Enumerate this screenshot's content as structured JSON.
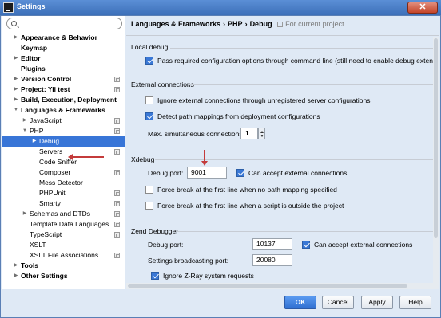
{
  "window": {
    "title": "Settings",
    "close_label": "✕"
  },
  "search": {
    "value": "",
    "placeholder": ""
  },
  "tree": [
    {
      "label": "Appearance & Behavior",
      "bold": true,
      "arrow": "▶",
      "indent": 0
    },
    {
      "label": "Keymap",
      "bold": true,
      "arrow": "",
      "indent": 0
    },
    {
      "label": "Editor",
      "bold": true,
      "arrow": "▶",
      "indent": 0
    },
    {
      "label": "Plugins",
      "bold": true,
      "arrow": "",
      "indent": 0
    },
    {
      "label": "Version Control",
      "bold": true,
      "arrow": "▶",
      "indent": 0,
      "project": true
    },
    {
      "label": "Project: Yii test",
      "bold": true,
      "arrow": "▶",
      "indent": 0,
      "project": true
    },
    {
      "label": "Build, Execution, Deployment",
      "bold": true,
      "arrow": "▶",
      "indent": 0
    },
    {
      "label": "Languages & Frameworks",
      "bold": true,
      "arrow": "▼",
      "indent": 0
    },
    {
      "label": "JavaScript",
      "bold": false,
      "arrow": "▶",
      "indent": 1,
      "project": true
    },
    {
      "label": "PHP",
      "bold": false,
      "arrow": "▼",
      "indent": 1,
      "project": true
    },
    {
      "label": "Debug",
      "bold": false,
      "arrow": "▶",
      "indent": 2,
      "selected": true
    },
    {
      "label": "Servers",
      "bold": false,
      "arrow": "",
      "indent": 2,
      "project": true
    },
    {
      "label": "Code Sniffer",
      "bold": false,
      "arrow": "",
      "indent": 2
    },
    {
      "label": "Composer",
      "bold": false,
      "arrow": "",
      "indent": 2,
      "project": true
    },
    {
      "label": "Mess Detector",
      "bold": false,
      "arrow": "",
      "indent": 2
    },
    {
      "label": "PHPUnit",
      "bold": false,
      "arrow": "",
      "indent": 2,
      "project": true
    },
    {
      "label": "Smarty",
      "bold": false,
      "arrow": "",
      "indent": 2,
      "project": true
    },
    {
      "label": "Schemas and DTDs",
      "bold": false,
      "arrow": "▶",
      "indent": 1,
      "project": true
    },
    {
      "label": "Template Data Languages",
      "bold": false,
      "arrow": "",
      "indent": 1,
      "project": true
    },
    {
      "label": "TypeScript",
      "bold": false,
      "arrow": "",
      "indent": 1,
      "project": true
    },
    {
      "label": "XSLT",
      "bold": false,
      "arrow": "",
      "indent": 1
    },
    {
      "label": "XSLT File Associations",
      "bold": false,
      "arrow": "",
      "indent": 1,
      "project": true
    },
    {
      "label": "Tools",
      "bold": true,
      "arrow": "▶",
      "indent": 0
    },
    {
      "label": "Other Settings",
      "bold": true,
      "arrow": "▶",
      "indent": 0
    }
  ],
  "breadcrumb": {
    "part1": "Languages & Frameworks",
    "sep": "›",
    "part2": "PHP",
    "part3": "Debug",
    "for_current_project": "For current project"
  },
  "local_debug": {
    "title": "Local debug",
    "pass_config_label": "Pass required configuration options through command line (still need to enable debug extension manu",
    "pass_config_checked": true
  },
  "external": {
    "title": "External connections",
    "ignore_label": "Ignore external connections through unregistered server configurations",
    "ignore_checked": false,
    "detect_label": "Detect path mappings from deployment configurations",
    "detect_checked": true,
    "max_label": "Max. simultaneous connections:",
    "max_value": "1"
  },
  "xdebug": {
    "title": "Xdebug",
    "port_label": "Debug port:",
    "port_value": "9001",
    "accept_label": "Can accept external connections",
    "accept_checked": true,
    "force_no_mapping_label": "Force break at the first line when no path mapping specified",
    "force_no_mapping_checked": false,
    "force_outside_label": "Force break at the first line when a script is outside the project",
    "force_outside_checked": false
  },
  "zend": {
    "title": "Zend Debugger",
    "port_label": "Debug port:",
    "port_value": "10137",
    "accept_label": "Can accept external connections",
    "accept_checked": true,
    "broadcast_label": "Settings broadcasting port:",
    "broadcast_value": "20080",
    "ignore_zray_label": "Ignore Z-Ray system requests",
    "ignore_zray_checked": true
  },
  "buttons": {
    "ok": "OK",
    "cancel": "Cancel",
    "apply": "Apply",
    "help": "Help"
  },
  "colors": {
    "selection": "#3875d7",
    "checkbox": "#3a78d6",
    "annotation_arrow": "#c43b3b",
    "panel_bg": "#dfe9f5"
  }
}
